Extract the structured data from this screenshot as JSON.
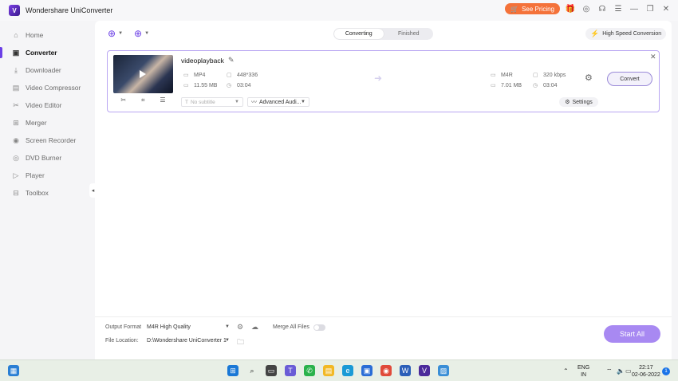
{
  "window": {
    "app_title": "Wondershare UniConverter",
    "pricing_label": "See Pricing",
    "icons": [
      "gift-icon",
      "user-icon",
      "support-icon",
      "menu-icon",
      "minimize-icon",
      "maximize-icon",
      "close-icon"
    ]
  },
  "sidebar": {
    "items": [
      {
        "label": "Home",
        "icon": "home-icon"
      },
      {
        "label": "Converter",
        "icon": "converter-icon",
        "active": true
      },
      {
        "label": "Downloader",
        "icon": "downloader-icon"
      },
      {
        "label": "Video Compressor",
        "icon": "compressor-icon"
      },
      {
        "label": "Video Editor",
        "icon": "editor-icon"
      },
      {
        "label": "Merger",
        "icon": "merger-icon"
      },
      {
        "label": "Screen Recorder",
        "icon": "recorder-icon"
      },
      {
        "label": "DVD Burner",
        "icon": "dvd-icon"
      },
      {
        "label": "Player",
        "icon": "player-icon"
      },
      {
        "label": "Toolbox",
        "icon": "toolbox-icon"
      }
    ]
  },
  "main": {
    "tabs": [
      {
        "label": "Converting",
        "active": true
      },
      {
        "label": "Finished",
        "active": false
      }
    ],
    "high_speed_label": "High Speed Conversion",
    "task": {
      "file_name": "videoplayback",
      "source": {
        "format": "MP4",
        "resolution": "448*336",
        "size": "11.55 MB",
        "duration": "03:04"
      },
      "target": {
        "format": "M4R",
        "bitrate": "320 kbps",
        "size": "7.01 MB",
        "duration": "03:04"
      },
      "convert_label": "Convert",
      "subtitle_placeholder": "No subtitle",
      "audio_label": "Advanced Audi...",
      "settings_label": "Settings"
    }
  },
  "bottom": {
    "output_format_label": "Output Format",
    "output_format_value": "M4R High Quality",
    "merge_label": "Merge All Files",
    "file_location_label": "File Location:",
    "file_location_value": "D:\\Wondershare UniConverter 1",
    "start_all_label": "Start All"
  },
  "taskbar": {
    "lang_top": "ENG",
    "lang_bottom": "IN",
    "time": "22:17",
    "date": "02-06-2022",
    "notification_count": "1"
  }
}
